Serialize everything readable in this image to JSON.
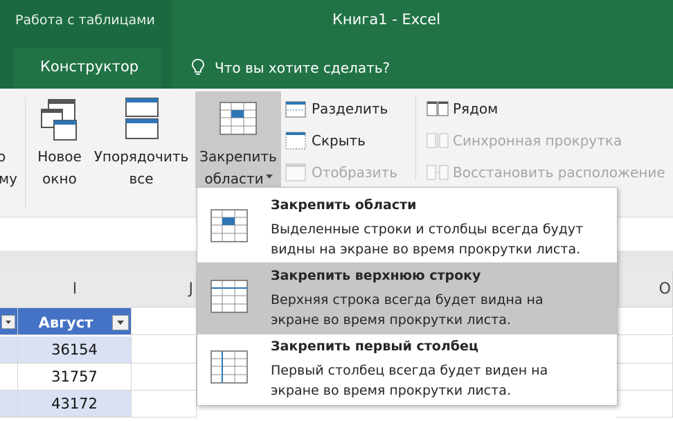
{
  "title_bar": {
    "context_group": "Работа с таблицами",
    "app_title": "Книга1  -  Excel",
    "context_tab": "Конструктор",
    "tell_me": "Что вы хотите сделать?"
  },
  "ribbon": {
    "left_cut_line1": "о",
    "left_cut_line2": "му",
    "new_window": [
      "Новое",
      "окно"
    ],
    "arrange_all": [
      "Упорядочить",
      "все"
    ],
    "freeze_panes": [
      "Закрепить",
      "области"
    ],
    "split": "Разделить",
    "hide": "Скрыть",
    "unhide": "Отобразить",
    "side_by_side": "Рядом",
    "sync_scroll": "Синхронная прокрутка",
    "reset_position": "Восстановить расположение"
  },
  "sheet": {
    "col_headers": [
      "I",
      "J",
      "O"
    ],
    "table_header": "Август",
    "values": [
      "36154",
      "31757",
      "43172"
    ]
  },
  "freeze_menu": {
    "items": [
      {
        "title": "Закрепить области",
        "desc1": "Выделенные строки и столбцы всегда будут",
        "desc2": "видны на экране во время прокрутки листа."
      },
      {
        "title": "Закрепить верхнюю строку",
        "desc1": "Верхняя строка всегда будет видна на",
        "desc2": "экране во время прокрутки листа."
      },
      {
        "title": "Закрепить первый столбец",
        "desc1": "Первый столбец всегда будет виден на",
        "desc2": "экране во время прокрутки листа."
      }
    ]
  },
  "colors": {
    "excel_green": "#217346",
    "context_green": "#1b6a3f",
    "table_header_blue": "#4472c4",
    "table_band_blue": "#d9e1f2",
    "menu_highlight": "#c6c6c6"
  }
}
